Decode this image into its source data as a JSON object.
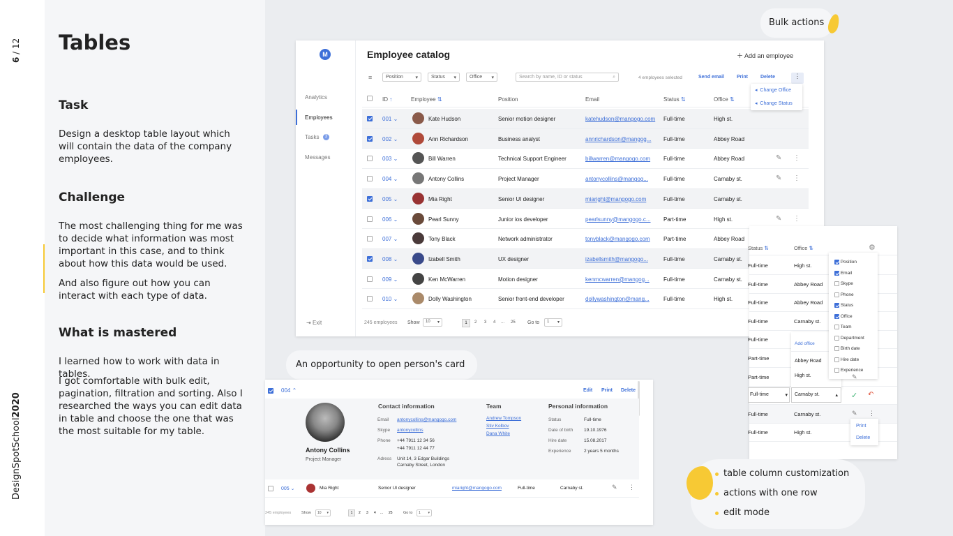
{
  "slide": {
    "page_num": "6",
    "page_total": "/ 12",
    "brand": "DesignSpotSchool",
    "year": "2020"
  },
  "left": {
    "title": "Tables",
    "task_heading": "Task",
    "task_text": "Design a desktop table layout which will contain the data of the company employees.",
    "challenge_heading": "Challenge",
    "challenge_text1": "The most challenging thing for me was to decide what information was most important in this case, and to think about how this data would be used.",
    "challenge_text2": "And also figure out how you can interact with each type of data.",
    "mastered_heading": "What is mastered",
    "mastered_text1": "I learned how to work with data in tables.",
    "mastered_text2": "I got comfortable with bulk edit, pagination, filtration and sorting. Also I researched the ways you can edit data in table and choose the one that was the most suitable for my table."
  },
  "callouts": {
    "bulk_actions": "Bulk actions",
    "open_card": "An opportunity to open person's card",
    "bullets": [
      "table column customization",
      "actions with one row",
      "edit mode"
    ]
  },
  "app": {
    "logo": "M",
    "title": "Employee catalog",
    "add_employee": "Add an employee",
    "sidebar": [
      "Analytics",
      "Employees",
      "Tasks",
      "Messages"
    ],
    "tasks_badge": "3",
    "exit": "Exit",
    "filters": [
      "Position",
      "Status",
      "Office"
    ],
    "search_placeholder": "Search by name, ID or status",
    "selected_count": "4 employees selected",
    "bulk": [
      "Send email",
      "Print",
      "Delete"
    ],
    "bulk_menu": [
      "Change Office",
      "Change Status"
    ],
    "columns": [
      "ID",
      "Employee",
      "Position",
      "Email",
      "Status",
      "Office"
    ],
    "rows": [
      {
        "id": "001",
        "name": "Kate Hudson",
        "position": "Senior motion designer",
        "email": "katehudson@mangogo.com",
        "status": "Full-time",
        "office": "High st.",
        "checked": true
      },
      {
        "id": "002",
        "name": "Ann Richardson",
        "position": "Business analyst",
        "email": "annrichardson@mangog...",
        "status": "Full-time",
        "office": "Abbey Road",
        "checked": true
      },
      {
        "id": "003",
        "name": "Bill Warren",
        "position": "Technical Support Engineer",
        "email": "billwarren@mangogo.com",
        "status": "Full-time",
        "office": "Abbey Road",
        "checked": false
      },
      {
        "id": "004",
        "name": "Antony Collins",
        "position": "Project Manager",
        "email": "antonycollins@mangog...",
        "status": "Full-time",
        "office": "Carnaby st.",
        "checked": false
      },
      {
        "id": "005",
        "name": "Mia Right",
        "position": "Senior UI designer",
        "email": "miaright@mangogo.com",
        "status": "Full-time",
        "office": "Carnaby st.",
        "checked": true
      },
      {
        "id": "006",
        "name": "Pearl Sunny",
        "position": "Junior ios developer",
        "email": "pearlsunny@mangogo.c...",
        "status": "Part-time",
        "office": "High st.",
        "checked": false
      },
      {
        "id": "007",
        "name": "Tony Black",
        "position": "Network administrator",
        "email": "tonyblack@mangogo.com",
        "status": "Part-time",
        "office": "Abbey Road",
        "checked": false
      },
      {
        "id": "008",
        "name": "Izabell Smith",
        "position": "UX designer",
        "email": "izabellsmith@mangogo...",
        "status": "Full-time",
        "office": "Carnaby st.",
        "checked": true
      },
      {
        "id": "009",
        "name": "Ken McWarren",
        "position": "Motion designer",
        "email": "kenmcwarren@mangog...",
        "status": "Full-time",
        "office": "Carnaby st.",
        "checked": false
      },
      {
        "id": "010",
        "name": "Dolly Washington",
        "position": "Senior front-end developer",
        "email": "dollywashington@mang...",
        "status": "Full-time",
        "office": "High st.",
        "checked": false
      }
    ],
    "footer": {
      "count": "245 employees",
      "show_label": "Show",
      "show_value": "10",
      "pages": [
        "1",
        "2",
        "3",
        "4",
        "...",
        "25"
      ],
      "goto_label": "Go to",
      "goto_value": "1"
    }
  },
  "detail": {
    "id": "004",
    "actions": [
      "Edit",
      "Print",
      "Delete"
    ],
    "name": "Antony Collins",
    "role": "Project Manager",
    "contact_heading": "Contact information",
    "email_label": "Email",
    "email": "antonycollins@mangogo.com",
    "skype_label": "Skype",
    "skype": "antonycollins",
    "phone_label": "Phone",
    "phone1": "+44 7911 12 34 56",
    "phone2": "+44 7911 12 44 77",
    "address_label": "Adress",
    "address1": "Unit 14, 3 Edgar Buildings",
    "address2": "Carnaby Street, London",
    "team_heading": "Team",
    "team": [
      "Andrew Tompson",
      "Stiv Kolbov",
      "Dana White"
    ],
    "personal_heading": "Personal information",
    "status_label": "Status",
    "status": "Full-time",
    "dob_label": "Date of birth",
    "dob": "19.10.1976",
    "hire_label": "Hire date",
    "hire": "15.08.2017",
    "exp_label": "Experience",
    "exp": "2 years 5 months",
    "next_row": {
      "id": "005",
      "name": "Mia Right",
      "position": "Senior UI designer",
      "email": "miaright@mangogo.com",
      "status": "Full-time",
      "office": "Carnaby st."
    },
    "footer_count": "245 employees",
    "show_label": "Show",
    "show_value": "10",
    "pages": [
      "1",
      "2",
      "3",
      "4",
      "...",
      "25"
    ],
    "goto_label": "Go to",
    "goto_value": "1"
  },
  "custom": {
    "col_status": "Status",
    "col_office": "Office",
    "status_vals": [
      "Full-time",
      "Full-time",
      "Full-time",
      "Full-time",
      "Full-time",
      "Part-time",
      "Part-time",
      "Full-time",
      "Full-time",
      "Full-time"
    ],
    "office_vals": [
      "High st.",
      "Abbey Road",
      "Abbey Road",
      "Carnaby st.",
      "",
      "",
      "High st.",
      "Carnaby st.",
      "Carnaby st.",
      "High st."
    ],
    "add_office": "Add office",
    "abbey": "Abbey Road",
    "options": [
      {
        "label": "Position",
        "on": true
      },
      {
        "label": "Email",
        "on": true
      },
      {
        "label": "Skype",
        "on": false
      },
      {
        "label": "Phone",
        "on": false
      },
      {
        "label": "Status",
        "on": true
      },
      {
        "label": "Office",
        "on": true
      },
      {
        "label": "Team",
        "on": false
      },
      {
        "label": "Department",
        "on": false
      },
      {
        "label": "Birth date",
        "on": false
      },
      {
        "label": "Hire date",
        "on": false
      },
      {
        "label": "Experience",
        "on": false
      }
    ],
    "row_menu": [
      "Print",
      "Delete"
    ]
  }
}
